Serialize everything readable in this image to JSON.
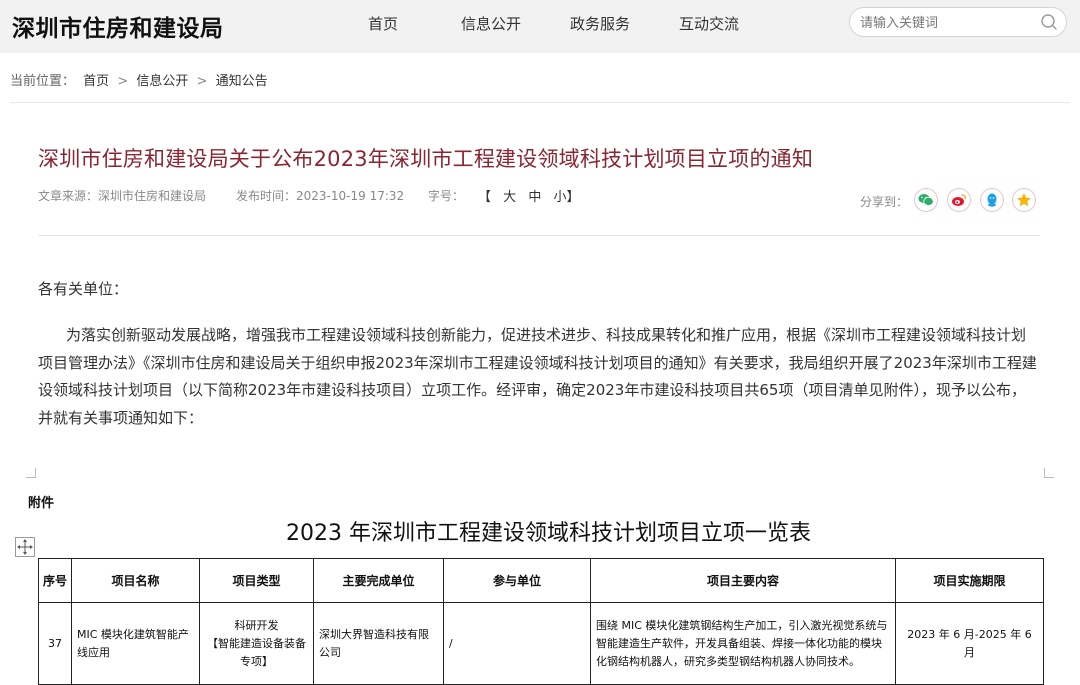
{
  "header": {
    "site_title": "深圳市住房和建设局",
    "nav": [
      "首页",
      "信息公开",
      "政务服务",
      "互动交流"
    ],
    "search_placeholder": "请输入关键词"
  },
  "breadcrumb": {
    "prefix": "当前位置：",
    "items": [
      "首页",
      "信息公开",
      "通知公告"
    ],
    "separator": ">"
  },
  "article": {
    "title": "深圳市住房和建设局关于公布2023年深圳市工程建设领域科技计划项目立项的通知",
    "source_label": "文章来源：",
    "source_value": "深圳市住房和建设局",
    "date_label": "发布时间：",
    "date_value": "2023-10-19 17:32",
    "fontsize_label": "字号：",
    "fontsize_options": [
      "【",
      "大",
      "中",
      "小】"
    ],
    "share_label": "分享到："
  },
  "share_icons": [
    {
      "name": "wechat-icon",
      "color": "#2aae67"
    },
    {
      "name": "weibo-icon",
      "color": "#e6162d"
    },
    {
      "name": "qq-icon",
      "color": "#1e9fe9"
    },
    {
      "name": "qzone-icon",
      "color": "#f5b50a"
    }
  ],
  "body": {
    "salutation": "各有关单位：",
    "paragraph": "为落实创新驱动发展战略，增强我市工程建设领域科技创新能力，促进技术进步、科技成果转化和推广应用，根据《深圳市工程建设领域科技计划项目管理办法》《深圳市住房和建设局关于组织申报2023年深圳市工程建设领域科技计划项目的通知》有关要求，我局组织开展了2023年深圳市工程建设领域科技计划项目（以下简称2023年市建设科技项目）立项工作。经评审，确定2023年市建设科技项目共65项（项目清单见附件），现予以公布，并就有关事项通知如下："
  },
  "attachment": {
    "label": "附件",
    "table_title": "2023 年深圳市工程建设领域科技计划项目立项一览表",
    "columns": [
      "序号",
      "项目名称",
      "项目类型",
      "主要完成单位",
      "参与单位",
      "项目主要内容",
      "项目实施期限"
    ],
    "rows": [
      {
        "no": "37",
        "name": "MIC 模块化建筑智能产线应用",
        "type_line1": "科研开发",
        "type_line2": "【智能建造设备装备专项】",
        "unit": "深圳大界智造科技有限公司",
        "participant": "/",
        "content": "围绕 MIC 模块化建筑钢结构生产加工，引入激光视觉系统与智能建造生产软件，开发具备组装、焊接一体化功能的模块化钢结构机器人，研究多类型钢结构机器人协同技术。",
        "period": "2023 年 6 月-2025 年 6 月"
      }
    ]
  }
}
